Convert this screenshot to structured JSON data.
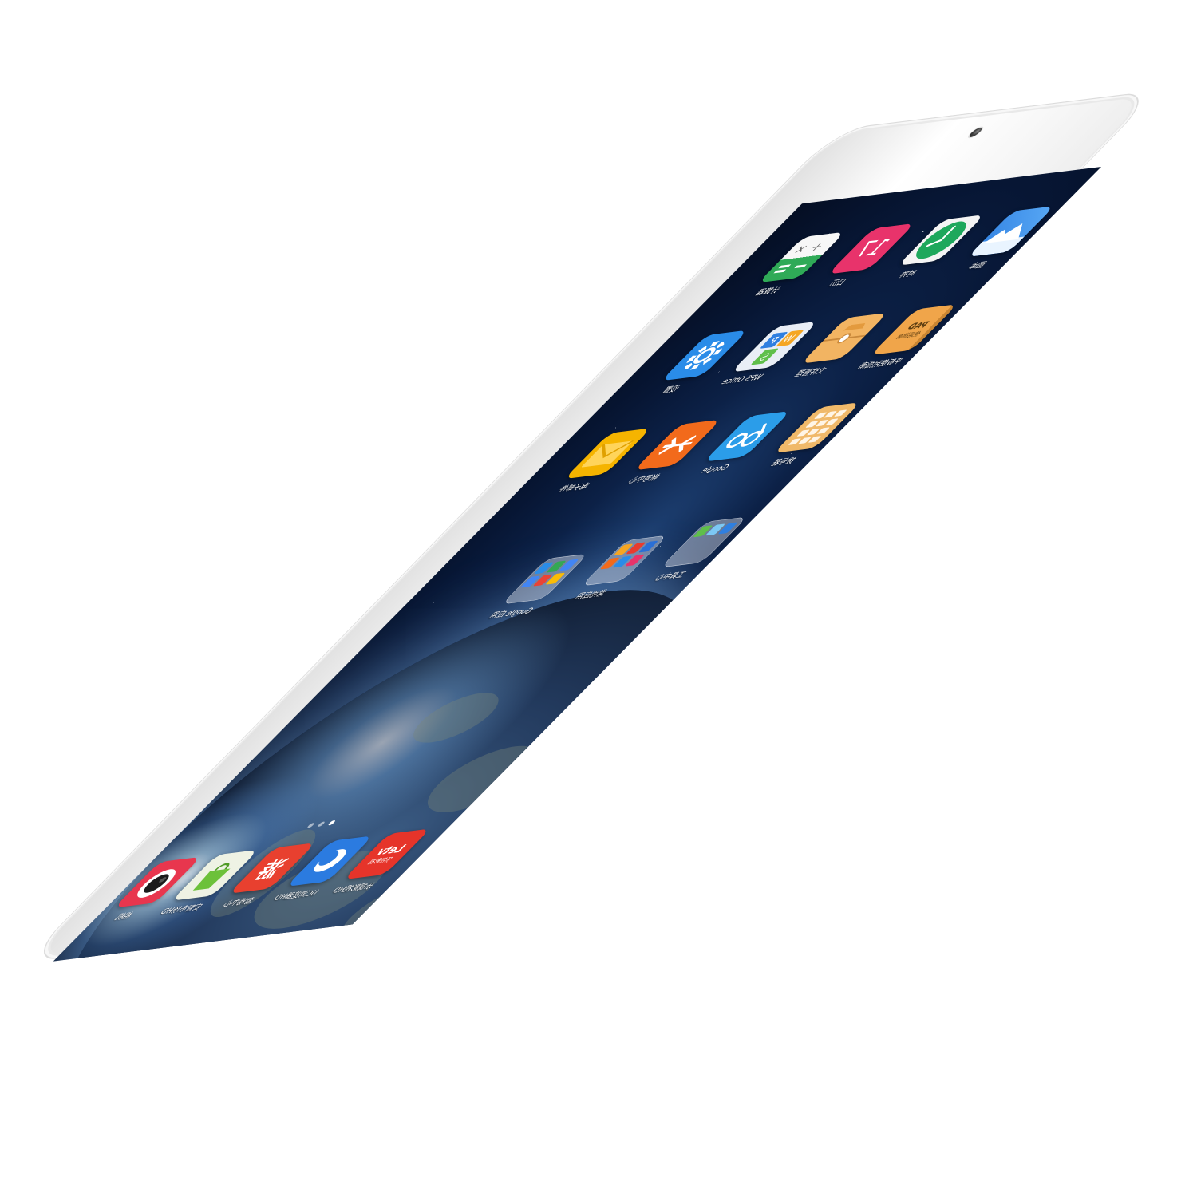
{
  "device": {
    "bezel_color": "#f7f7f7",
    "camera_icon": "front-camera-icon"
  },
  "home": {
    "apps": [
      {
        "label": "图库",
        "icon": "gallery-icon",
        "color": "#2f7fe0"
      },
      {
        "label": "时钟",
        "icon": "clock-icon",
        "color": "#1ea85c"
      },
      {
        "label": "日历",
        "icon": "calendar-icon",
        "color": "#e8336b",
        "value": "17"
      },
      {
        "label": "计算器",
        "icon": "calculator-icon",
        "color": "#e4e4e4"
      },
      {
        "label": "平板使用指南",
        "icon": "guide-book-icon",
        "color": "#f0a54a",
        "title": "PAD",
        "subtitle": "使用指南"
      },
      {
        "label": "文件管理",
        "icon": "file-manager-icon",
        "color": "#f2b462"
      },
      {
        "label": "WPS Office",
        "icon": "wps-office-icon",
        "color": "#e9eef6"
      },
      {
        "label": "设置",
        "icon": "settings-gear-icon",
        "color": "#2a8ce8"
      },
      {
        "label": "拨号器",
        "icon": "dialer-keypad-icon",
        "color": "#f0b96a"
      },
      {
        "label": "Google",
        "icon": "google-glasses-icon",
        "color": "#2b9de9"
      },
      {
        "label": "帐号中心",
        "icon": "account-center-icon",
        "color": "#f26a1b"
      },
      {
        "label": "电子邮件",
        "icon": "email-envelope-icon",
        "color": "#f5b400"
      }
    ],
    "folders": [
      {
        "label": "工具中心",
        "icon": "folder-icon",
        "colors": [
          "#2f7fe0",
          "#7cc8f4",
          "#5fbf4a"
        ]
      },
      {
        "label": "常用应用",
        "icon": "folder-icon",
        "colors": [
          "#2a6fd6",
          "#e83b2f",
          "#f5a623",
          "#e8336b",
          "#2a8ce8",
          "#f26a1b"
        ]
      },
      {
        "label": "Google 应用",
        "icon": "folder-icon",
        "colors": [
          "#4285f4",
          "#34a853",
          "#2a8ce8",
          "#fbbc05",
          "#ea4335",
          "#4285f4"
        ]
      }
    ],
    "page_dots": 3,
    "active_page": 0
  },
  "dock": {
    "apps": [
      {
        "label": "乐视影视HD",
        "icon": "letv-icon",
        "color": "#e6342a",
        "title": "Letv",
        "subtitle": "乐视影视"
      },
      {
        "label": "UC浏览器HD",
        "icon": "uc-browser-icon",
        "color": "#2b7be0"
      },
      {
        "label": "游戏中心",
        "icon": "game-center-icon",
        "color": "#e8402f",
        "value": "游"
      },
      {
        "label": "安智市场HD",
        "icon": "anzhi-market-icon",
        "color": "#eef2e4"
      },
      {
        "label": "相机",
        "icon": "camera-icon",
        "color": "#e8364e"
      }
    ]
  }
}
